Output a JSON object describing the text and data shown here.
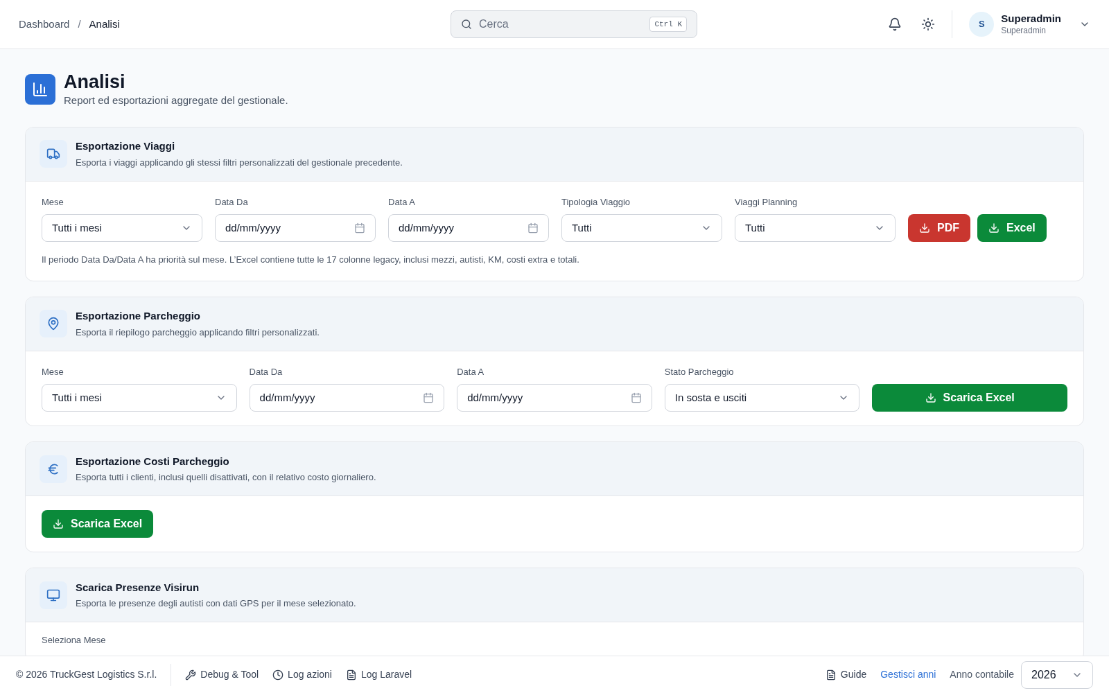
{
  "breadcrumb": [
    "Dashboard",
    "Analisi"
  ],
  "breadcrumb_separator": "/",
  "search": {
    "placeholder": "Cerca",
    "shortcut": "Ctrl K"
  },
  "user": {
    "initial": "S",
    "name": "Superadmin",
    "role": "Superadmin"
  },
  "page": {
    "title": "Analisi",
    "subtitle": "Report ed esportazioni aggregate del gestionale."
  },
  "sections": [
    {
      "title": "Esportazione Viaggi",
      "description": "Esporta i viaggi applicando gli stessi filtri personalizzati del gestionale precedente.",
      "fields": [
        {
          "label": "Mese",
          "kind": "select",
          "value": "Tutti i mesi"
        },
        {
          "label": "Data Da",
          "kind": "date",
          "placeholder": "dd/mm/yyyy"
        },
        {
          "label": "Data A",
          "kind": "date",
          "placeholder": "dd/mm/yyyy"
        },
        {
          "label": "Tipologia Viaggio",
          "kind": "select",
          "value": "Tutti"
        },
        {
          "label": "Viaggi Planning",
          "kind": "select",
          "value": "Tutti"
        }
      ],
      "buttons": [
        {
          "label": "PDF",
          "color": "#c9362f"
        },
        {
          "label": "Excel",
          "color": "#0b8a3a"
        }
      ],
      "note": "Il periodo Data Da/Data A ha priorità sul mese. L’Excel contiene tutte le 17 colonne legacy, inclusi mezzi, autisti, KM, costi extra e totali."
    },
    {
      "title": "Esportazione Parcheggio",
      "description": "Esporta il riepilogo parcheggio applicando filtri personalizzati.",
      "fields": [
        {
          "label": "Mese",
          "kind": "select",
          "value": "Tutti i mesi"
        },
        {
          "label": "Data Da",
          "kind": "date",
          "placeholder": "dd/mm/yyyy"
        },
        {
          "label": "Data A",
          "kind": "date",
          "placeholder": "dd/mm/yyyy"
        },
        {
          "label": "Stato Parcheggio",
          "kind": "select",
          "value": "In sosta e usciti"
        }
      ],
      "buttons": [
        {
          "label": "Scarica Excel",
          "color": "#0b8a3a"
        }
      ]
    },
    {
      "title": "Esportazione Costi Parcheggio",
      "description": "Esporta tutti i clienti, inclusi quelli disattivati, con il relativo costo giornaliero.",
      "buttons": [
        {
          "label": "Scarica Excel",
          "color": "#0b8a3a"
        }
      ]
    },
    {
      "title": "Scarica Presenze Visirun",
      "description": "Esporta le presenze degli autisti con dati GPS per il mese selezionato.",
      "cut_label": "Seleziona Mese"
    }
  ],
  "footer": {
    "copyright": "© 2026 TruckGest Logistics S.r.l.",
    "links": [
      {
        "label": "Debug & Tool"
      },
      {
        "label": "Log azioni"
      },
      {
        "label": "Log Laravel"
      }
    ],
    "guide": "Guide",
    "manage": "Gestisci anni",
    "year_label": "Anno contabile",
    "year": "2026"
  }
}
